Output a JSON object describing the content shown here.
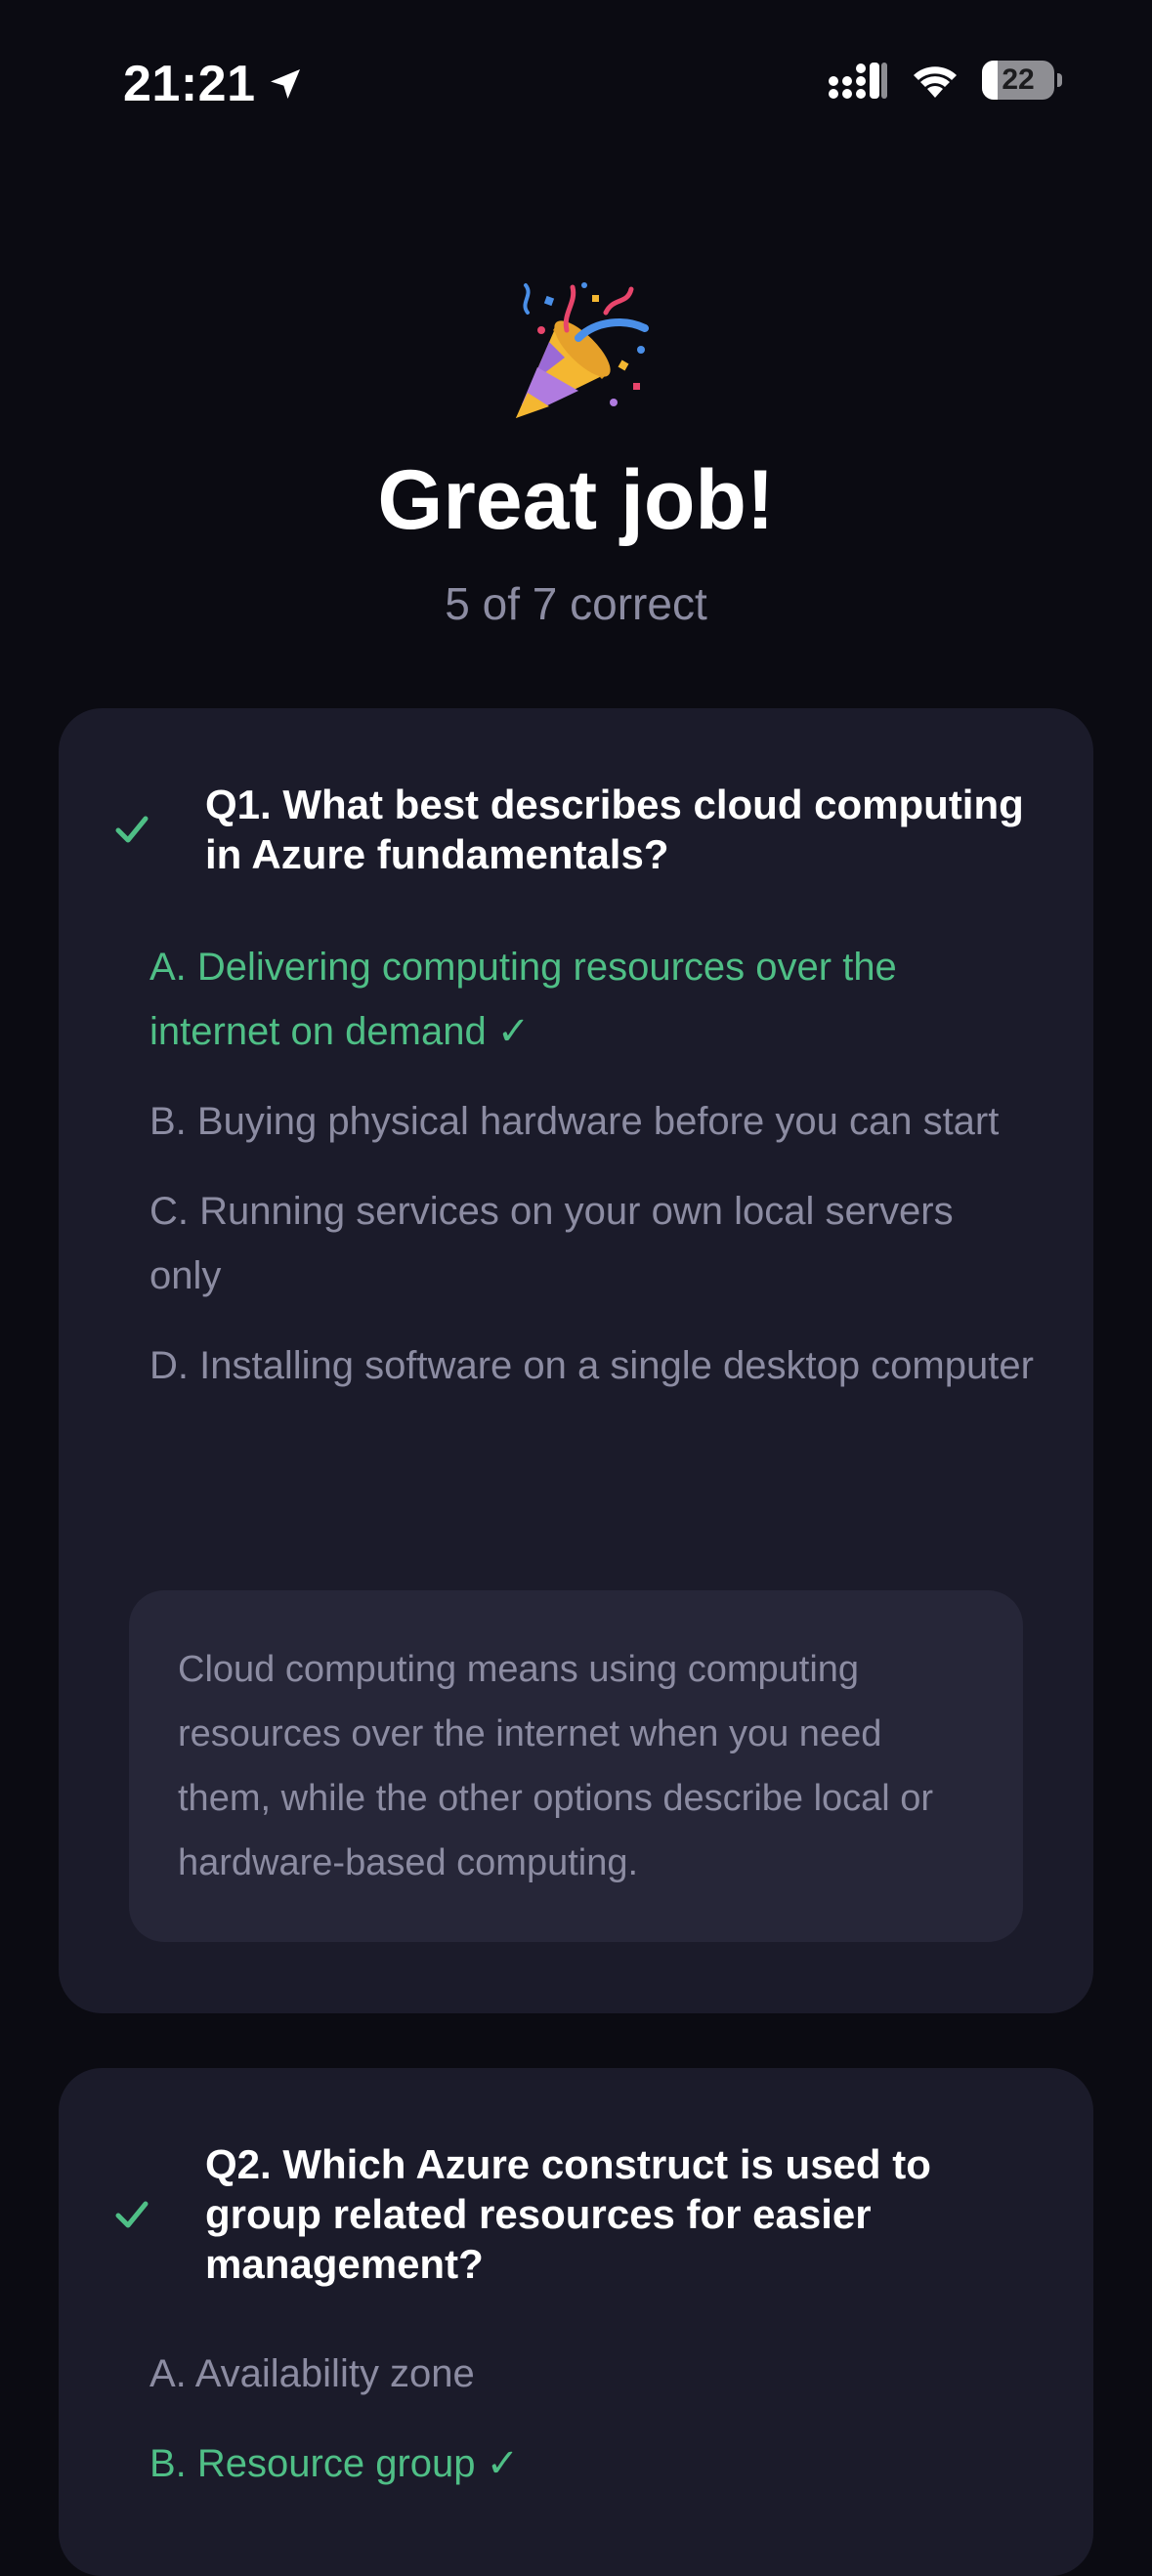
{
  "status_bar": {
    "time": "21:21",
    "battery_level": "22",
    "battery_fraction": 0.22
  },
  "result": {
    "title": "Great job!",
    "subtitle": "5 of 7 correct",
    "icon": "party-popper-icon"
  },
  "colors": {
    "background": "#0b0b12",
    "card": "#1b1b2a",
    "explanation_bg": "#262638",
    "correct": "#4fbf86",
    "muted": "#8c8ca2"
  },
  "questions": [
    {
      "status": "correct",
      "title": "Q1. What best describes cloud computing in Azure fundamentals?",
      "options": [
        {
          "text": "A. Delivering computing resources over the internet on demand ✓",
          "correct": true
        },
        {
          "text": "B. Buying physical hardware before you can start",
          "correct": false
        },
        {
          "text": "C. Running services on your own local servers only",
          "correct": false
        },
        {
          "text": "D. Installing software on a single desktop computer",
          "correct": false
        }
      ],
      "explanation": "Cloud computing means using computing resources over the internet when you need them, while the other options describe local or hardware-based computing."
    },
    {
      "status": "correct",
      "title": "Q2. Which Azure construct is used to group related resources for easier management?",
      "options": [
        {
          "text": "A. Availability zone",
          "correct": false
        },
        {
          "text": "B. Resource group ✓",
          "correct": true
        }
      ]
    }
  ]
}
